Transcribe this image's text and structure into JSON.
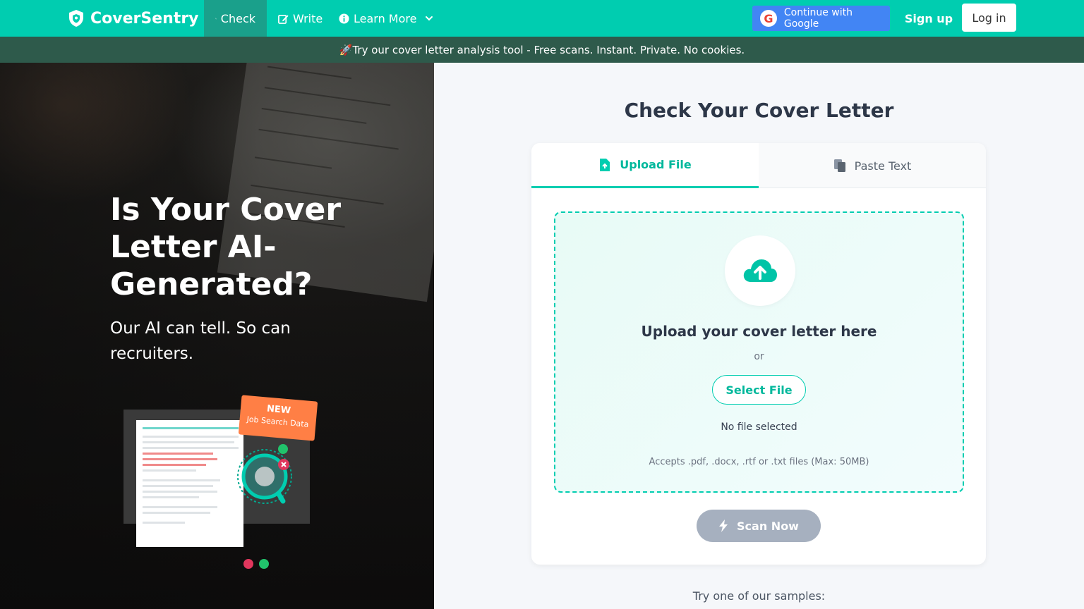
{
  "nav": {
    "brand": "CoverSentry",
    "links": [
      {
        "label": "Check",
        "icon": "search-icon",
        "active": true
      },
      {
        "label": "Write",
        "icon": "edit-icon",
        "active": false
      },
      {
        "label": "Learn More",
        "icon": "info-icon",
        "active": false
      }
    ],
    "google_label": "Continue with Google",
    "signup_label": "Sign up",
    "login_label": "Log in"
  },
  "banner": {
    "text": "🚀Try our cover letter analysis tool - Free scans. Instant. Private. No cookies."
  },
  "hero": {
    "title": "Is Your Cover Letter AI-Generated?",
    "subtitle": "Our AI can tell. So can recruiters.",
    "badge_title": "NEW",
    "badge_sub": "Job Search Data"
  },
  "checker": {
    "title": "Check Your Cover Letter",
    "tabs": [
      {
        "label": "Upload File",
        "icon": "file-upload-icon",
        "active": true
      },
      {
        "label": "Paste Text",
        "icon": "paste-icon",
        "active": false
      }
    ],
    "drop_title": "Upload your cover letter here",
    "or": "or",
    "select_label": "Select File",
    "no_file": "No file selected",
    "accepts": "Accepts .pdf, .docx, .rtf or .txt files (Max: 50MB)",
    "scan_label": "Scan Now"
  },
  "samples": {
    "label": "Try one of our samples:"
  },
  "colors": {
    "brand": "#00cdb0",
    "banner": "#2e5a4b",
    "google": "#4285f4",
    "badge": "#ff7f45",
    "disabled": "#a6b0bf"
  }
}
